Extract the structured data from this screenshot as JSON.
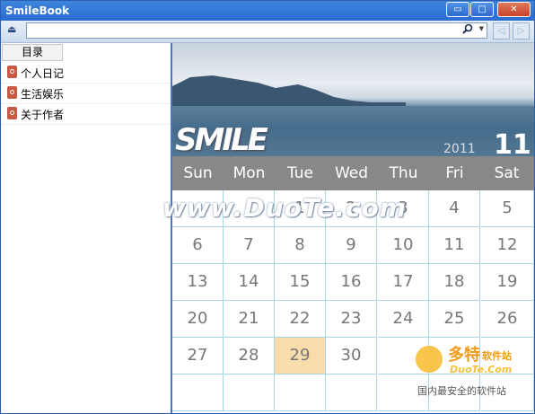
{
  "window": {
    "title": "SmileBook"
  },
  "titlebar_buttons": {
    "minimize": "▭",
    "maximize": "□",
    "close": "✕"
  },
  "toolbar": {
    "eject_glyph": "⏏",
    "address_value": "",
    "search_icon": "search-icon",
    "back": "◁",
    "forward": "▷"
  },
  "sidebar": {
    "tab_label": "目录",
    "items": [
      {
        "label": "个人日记",
        "icon": "book-icon"
      },
      {
        "label": "生活娱乐",
        "icon": "book-icon"
      },
      {
        "label": "关于作者",
        "icon": "book-icon"
      }
    ]
  },
  "banner": {
    "logo_text": "SMILE",
    "year": "2011",
    "month": "11"
  },
  "calendar": {
    "weekdays": [
      "Sun",
      "Mon",
      "Tue",
      "Wed",
      "Thu",
      "Fri",
      "Sat"
    ],
    "weeks": [
      [
        "",
        "",
        "1",
        "2",
        "3",
        "4",
        "5"
      ],
      [
        "6",
        "7",
        "8",
        "9",
        "10",
        "11",
        "12"
      ],
      [
        "13",
        "14",
        "15",
        "16",
        "17",
        "18",
        "19"
      ],
      [
        "20",
        "21",
        "22",
        "23",
        "24",
        "25",
        "26"
      ],
      [
        "27",
        "28",
        "29",
        "30",
        "",
        "",
        ""
      ],
      [
        "",
        "",
        "",
        "",
        "",
        "",
        ""
      ]
    ],
    "today": "29"
  },
  "watermark": {
    "text": "www.DuoTe.com",
    "brand_cn": "多特",
    "brand_sub": "软件站",
    "brand_en": "DuoTe.Com",
    "slogan": "国内最安全的软件站"
  },
  "colors": {
    "accent": "#2a6bd0",
    "weekday_bar": "#888888",
    "today_bg": "#f9dcab",
    "grid_line": "#a9d8e4"
  }
}
